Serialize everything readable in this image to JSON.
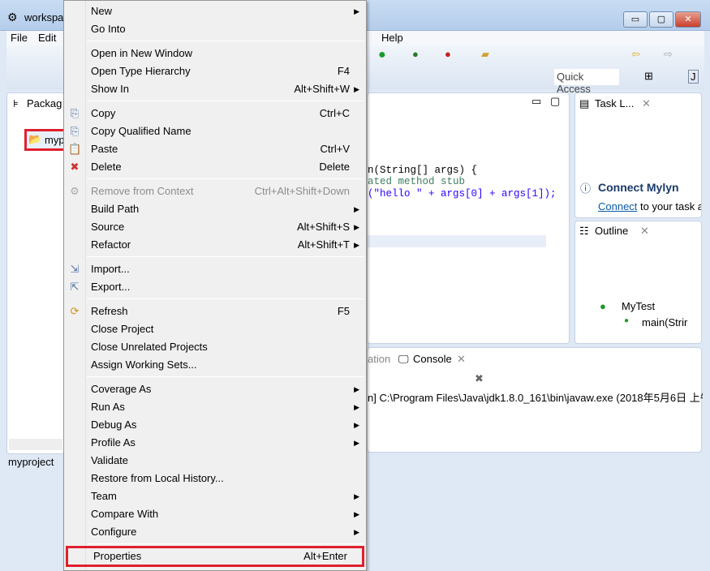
{
  "window": {
    "title": "workspa",
    "min": "▭",
    "max": "▢",
    "close": "✕"
  },
  "menubar": [
    "File",
    "Edit",
    "Help"
  ],
  "quick_access": "Quick Access",
  "package_explorer": {
    "tab": "Packag",
    "project": "myp",
    "status": "myproject"
  },
  "editor": {
    "lines": [
      "n(String[] args) {",
      "ated method stub",
      "(\"hello \" + args[0] + args[1]);"
    ]
  },
  "task_list": {
    "tab": "Task L...",
    "connect_title": "Connect Mylyn",
    "connect_link": "Connect",
    "connect_rest": " to your task a"
  },
  "outline": {
    "tab": "Outline",
    "class": "MyTest",
    "method": "main(Strir"
  },
  "console": {
    "prev_tab": "ation",
    "tab": "Console",
    "line": "n] C:\\Program Files\\Java\\jdk1.8.0_161\\bin\\javaw.exe (2018年5月6日 上午"
  },
  "context_menu": {
    "groups": [
      [
        {
          "label": "New",
          "sub": true
        },
        {
          "label": "Go Into"
        }
      ],
      [
        {
          "label": "Open in New Window"
        },
        {
          "label": "Open Type Hierarchy",
          "shortcut": "F4"
        },
        {
          "label": "Show In",
          "shortcut": "Alt+Shift+W",
          "sub": true
        }
      ],
      [
        {
          "label": "Copy",
          "shortcut": "Ctrl+C",
          "icon": "copy-icon"
        },
        {
          "label": "Copy Qualified Name",
          "icon": "copy-qualified-icon"
        },
        {
          "label": "Paste",
          "shortcut": "Ctrl+V",
          "icon": "paste-icon"
        },
        {
          "label": "Delete",
          "shortcut": "Delete",
          "icon": "delete-icon"
        }
      ],
      [
        {
          "label": "Remove from Context",
          "shortcut": "Ctrl+Alt+Shift+Down",
          "disabled": true,
          "icon": "remove-context-icon"
        },
        {
          "label": "Build Path",
          "sub": true
        },
        {
          "label": "Source",
          "shortcut": "Alt+Shift+S",
          "sub": true
        },
        {
          "label": "Refactor",
          "shortcut": "Alt+Shift+T",
          "sub": true
        }
      ],
      [
        {
          "label": "Import...",
          "icon": "import-icon"
        },
        {
          "label": "Export...",
          "icon": "export-icon"
        }
      ],
      [
        {
          "label": "Refresh",
          "shortcut": "F5",
          "icon": "refresh-icon"
        },
        {
          "label": "Close Project"
        },
        {
          "label": "Close Unrelated Projects"
        },
        {
          "label": "Assign Working Sets..."
        }
      ],
      [
        {
          "label": "Coverage As",
          "sub": true
        },
        {
          "label": "Run As",
          "sub": true
        },
        {
          "label": "Debug As",
          "sub": true
        },
        {
          "label": "Profile As",
          "sub": true
        },
        {
          "label": "Validate"
        },
        {
          "label": "Restore from Local History..."
        },
        {
          "label": "Team",
          "sub": true
        },
        {
          "label": "Compare With",
          "sub": true
        },
        {
          "label": "Configure",
          "sub": true
        }
      ],
      [
        {
          "label": "Properties",
          "shortcut": "Alt+Enter",
          "highlighted": true
        }
      ]
    ]
  },
  "colors": {
    "highlight": "#e0202e",
    "link": "#0b5aa8",
    "string": "#2a00ff",
    "comment": "#3f7f5f"
  }
}
